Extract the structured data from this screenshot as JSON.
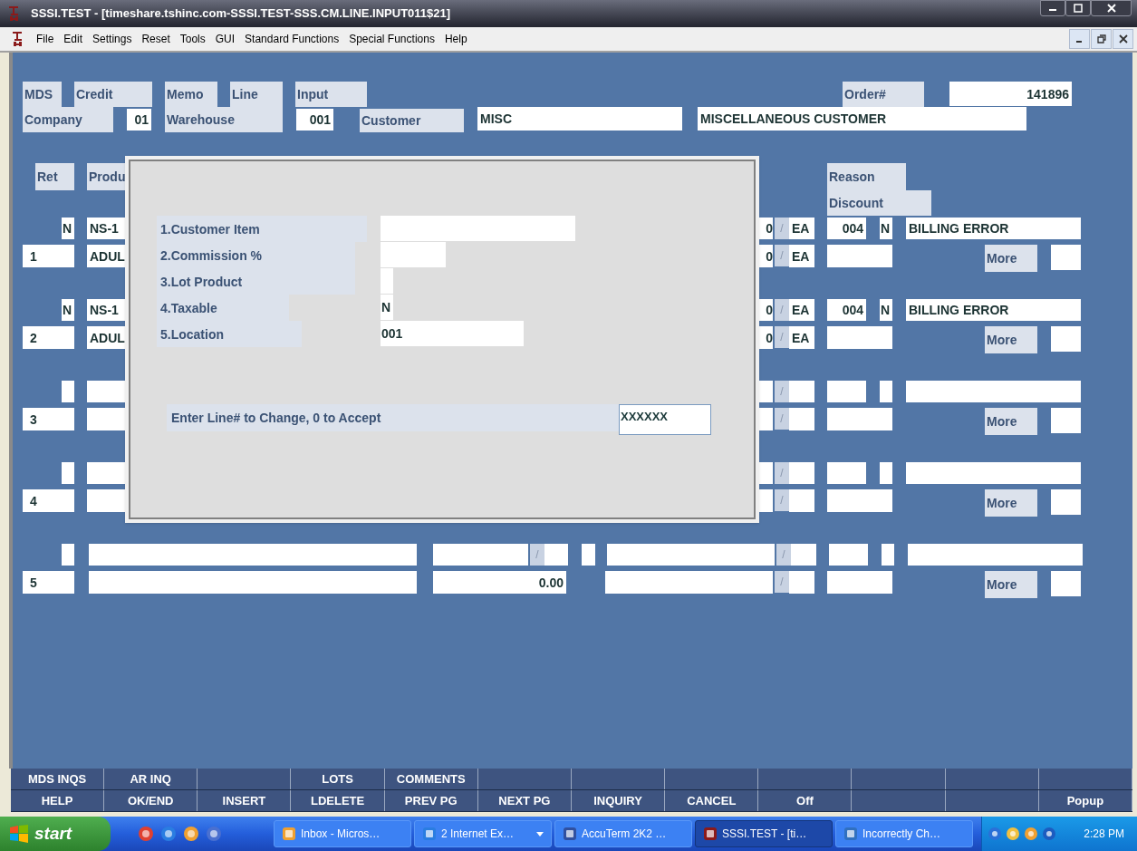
{
  "window": {
    "title": "SSSI.TEST - [timeshare.tshinc.com-SSSI.TEST-SSS.CM.LINE.INPUT011$21]"
  },
  "menu": [
    "File",
    "Edit",
    "Settings",
    "Reset",
    "Tools",
    "GUI",
    "Standard Functions",
    "Special Functions",
    "Help"
  ],
  "header": {
    "title_labels": [
      "MDS",
      "Credit",
      "Memo",
      "Line",
      "Input"
    ],
    "order_label": "Order#",
    "order_value": "141896",
    "company_label": "Company",
    "company_value": "01",
    "warehouse_label": "Warehouse",
    "warehouse_value": "001",
    "customer_label": "Customer",
    "customer_code": "MISC",
    "customer_name": "MISCELLANEOUS CUSTOMER"
  },
  "columns": {
    "ret": "Ret",
    "product": "Produ",
    "reason": "Reason",
    "discount": "Discount"
  },
  "lines": [
    {
      "kind": "behind_dialog",
      "line": "1",
      "ret": "N",
      "product": "NS-1",
      "description": "ADUL",
      "qty_a": "0",
      "qty_b": "0",
      "sep_a": "/",
      "sep_b": "/",
      "um_a": "EA",
      "um_b": "EA",
      "reason_code": "004",
      "discount": "N",
      "reason_text": "BILLING ERROR",
      "more": "More"
    },
    {
      "kind": "behind_dialog",
      "line": "2",
      "ret": "N",
      "product": "NS-1",
      "description": "ADUL",
      "qty_a": "0",
      "qty_b": "0",
      "sep_a": "/",
      "sep_b": "/",
      "um_a": "EA",
      "um_b": "EA",
      "reason_code": "004",
      "discount": "N",
      "reason_text": "BILLING ERROR",
      "more": "More"
    },
    {
      "kind": "behind_dialog",
      "line": "3",
      "sep_a": "/",
      "sep_b": "/",
      "more": "More"
    },
    {
      "kind": "behind_dialog",
      "line": "4",
      "sep_a": "/",
      "sep_b": "/",
      "more": "More"
    },
    {
      "kind": "full",
      "line": "5",
      "price_sep": "/",
      "price": "0.00",
      "sep_a": "/",
      "sep_b": "/",
      "more": "More"
    }
  ],
  "dialog": {
    "fields": [
      {
        "label": "1.Customer Item"
      },
      {
        "label": "2.Commission %"
      },
      {
        "label": "3.Lot Product"
      },
      {
        "label": "4.Taxable",
        "value": "N"
      },
      {
        "label": "5.Location",
        "value": "001"
      }
    ],
    "prompt": "Enter Line# to Change, 0 to Accept",
    "answer": "XXXXXX"
  },
  "function_keys": [
    [
      {
        "kind": "key",
        "label": "MDS INQS"
      },
      {
        "kind": "key",
        "label": "AR INQ"
      },
      {
        "kind": "blank"
      },
      {
        "kind": "key",
        "label": "LOTS"
      },
      {
        "kind": "key",
        "label": "COMMENTS"
      },
      {
        "kind": "blank"
      },
      {
        "kind": "blank"
      },
      {
        "kind": "blank"
      },
      {
        "kind": "blank"
      },
      {
        "kind": "blank"
      },
      {
        "kind": "blank"
      },
      {
        "kind": "blank"
      }
    ],
    [
      {
        "kind": "key",
        "label": "HELP"
      },
      {
        "kind": "key",
        "label": "OK/END"
      },
      {
        "kind": "key",
        "label": "INSERT"
      },
      {
        "kind": "key",
        "label": "LDELETE"
      },
      {
        "kind": "key",
        "label": "PREV PG"
      },
      {
        "kind": "key",
        "label": "NEXT PG"
      },
      {
        "kind": "key",
        "label": "INQUIRY"
      },
      {
        "kind": "key",
        "label": "CANCEL"
      },
      {
        "kind": "key",
        "label": "Off"
      },
      {
        "kind": "blank"
      },
      {
        "kind": "blank"
      },
      {
        "kind": "key",
        "label": "Popup"
      }
    ]
  ],
  "taskbar": {
    "start": "start",
    "tasks": [
      {
        "label": "Inbox - Micros…",
        "selected": false,
        "grouped": false
      },
      {
        "label": "2 Internet Ex…",
        "selected": false,
        "grouped": true
      },
      {
        "label": "AccuTerm 2K2 …",
        "selected": false,
        "grouped": false
      },
      {
        "label": "SSSI.TEST - [ti…",
        "selected": true,
        "grouped": false
      },
      {
        "label": "Incorrectly Ch…",
        "selected": false,
        "grouped": false
      }
    ],
    "clock": "2:28 PM"
  }
}
